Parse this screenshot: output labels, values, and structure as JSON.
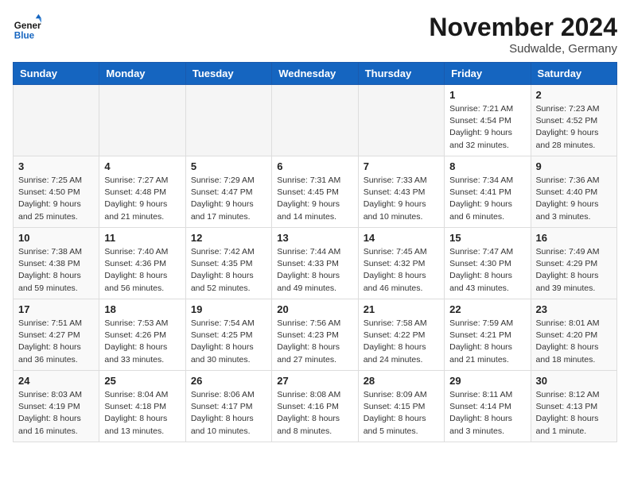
{
  "logo": {
    "line1": "General",
    "line2": "Blue"
  },
  "title": "November 2024",
  "location": "Sudwalde, Germany",
  "weekdays": [
    "Sunday",
    "Monday",
    "Tuesday",
    "Wednesday",
    "Thursday",
    "Friday",
    "Saturday"
  ],
  "weeks": [
    [
      {
        "day": "",
        "info": ""
      },
      {
        "day": "",
        "info": ""
      },
      {
        "day": "",
        "info": ""
      },
      {
        "day": "",
        "info": ""
      },
      {
        "day": "",
        "info": ""
      },
      {
        "day": "1",
        "info": "Sunrise: 7:21 AM\nSunset: 4:54 PM\nDaylight: 9 hours\nand 32 minutes."
      },
      {
        "day": "2",
        "info": "Sunrise: 7:23 AM\nSunset: 4:52 PM\nDaylight: 9 hours\nand 28 minutes."
      }
    ],
    [
      {
        "day": "3",
        "info": "Sunrise: 7:25 AM\nSunset: 4:50 PM\nDaylight: 9 hours\nand 25 minutes."
      },
      {
        "day": "4",
        "info": "Sunrise: 7:27 AM\nSunset: 4:48 PM\nDaylight: 9 hours\nand 21 minutes."
      },
      {
        "day": "5",
        "info": "Sunrise: 7:29 AM\nSunset: 4:47 PM\nDaylight: 9 hours\nand 17 minutes."
      },
      {
        "day": "6",
        "info": "Sunrise: 7:31 AM\nSunset: 4:45 PM\nDaylight: 9 hours\nand 14 minutes."
      },
      {
        "day": "7",
        "info": "Sunrise: 7:33 AM\nSunset: 4:43 PM\nDaylight: 9 hours\nand 10 minutes."
      },
      {
        "day": "8",
        "info": "Sunrise: 7:34 AM\nSunset: 4:41 PM\nDaylight: 9 hours\nand 6 minutes."
      },
      {
        "day": "9",
        "info": "Sunrise: 7:36 AM\nSunset: 4:40 PM\nDaylight: 9 hours\nand 3 minutes."
      }
    ],
    [
      {
        "day": "10",
        "info": "Sunrise: 7:38 AM\nSunset: 4:38 PM\nDaylight: 8 hours\nand 59 minutes."
      },
      {
        "day": "11",
        "info": "Sunrise: 7:40 AM\nSunset: 4:36 PM\nDaylight: 8 hours\nand 56 minutes."
      },
      {
        "day": "12",
        "info": "Sunrise: 7:42 AM\nSunset: 4:35 PM\nDaylight: 8 hours\nand 52 minutes."
      },
      {
        "day": "13",
        "info": "Sunrise: 7:44 AM\nSunset: 4:33 PM\nDaylight: 8 hours\nand 49 minutes."
      },
      {
        "day": "14",
        "info": "Sunrise: 7:45 AM\nSunset: 4:32 PM\nDaylight: 8 hours\nand 46 minutes."
      },
      {
        "day": "15",
        "info": "Sunrise: 7:47 AM\nSunset: 4:30 PM\nDaylight: 8 hours\nand 43 minutes."
      },
      {
        "day": "16",
        "info": "Sunrise: 7:49 AM\nSunset: 4:29 PM\nDaylight: 8 hours\nand 39 minutes."
      }
    ],
    [
      {
        "day": "17",
        "info": "Sunrise: 7:51 AM\nSunset: 4:27 PM\nDaylight: 8 hours\nand 36 minutes."
      },
      {
        "day": "18",
        "info": "Sunrise: 7:53 AM\nSunset: 4:26 PM\nDaylight: 8 hours\nand 33 minutes."
      },
      {
        "day": "19",
        "info": "Sunrise: 7:54 AM\nSunset: 4:25 PM\nDaylight: 8 hours\nand 30 minutes."
      },
      {
        "day": "20",
        "info": "Sunrise: 7:56 AM\nSunset: 4:23 PM\nDaylight: 8 hours\nand 27 minutes."
      },
      {
        "day": "21",
        "info": "Sunrise: 7:58 AM\nSunset: 4:22 PM\nDaylight: 8 hours\nand 24 minutes."
      },
      {
        "day": "22",
        "info": "Sunrise: 7:59 AM\nSunset: 4:21 PM\nDaylight: 8 hours\nand 21 minutes."
      },
      {
        "day": "23",
        "info": "Sunrise: 8:01 AM\nSunset: 4:20 PM\nDaylight: 8 hours\nand 18 minutes."
      }
    ],
    [
      {
        "day": "24",
        "info": "Sunrise: 8:03 AM\nSunset: 4:19 PM\nDaylight: 8 hours\nand 16 minutes."
      },
      {
        "day": "25",
        "info": "Sunrise: 8:04 AM\nSunset: 4:18 PM\nDaylight: 8 hours\nand 13 minutes."
      },
      {
        "day": "26",
        "info": "Sunrise: 8:06 AM\nSunset: 4:17 PM\nDaylight: 8 hours\nand 10 minutes."
      },
      {
        "day": "27",
        "info": "Sunrise: 8:08 AM\nSunset: 4:16 PM\nDaylight: 8 hours\nand 8 minutes."
      },
      {
        "day": "28",
        "info": "Sunrise: 8:09 AM\nSunset: 4:15 PM\nDaylight: 8 hours\nand 5 minutes."
      },
      {
        "day": "29",
        "info": "Sunrise: 8:11 AM\nSunset: 4:14 PM\nDaylight: 8 hours\nand 3 minutes."
      },
      {
        "day": "30",
        "info": "Sunrise: 8:12 AM\nSunset: 4:13 PM\nDaylight: 8 hours\nand 1 minute."
      }
    ]
  ]
}
